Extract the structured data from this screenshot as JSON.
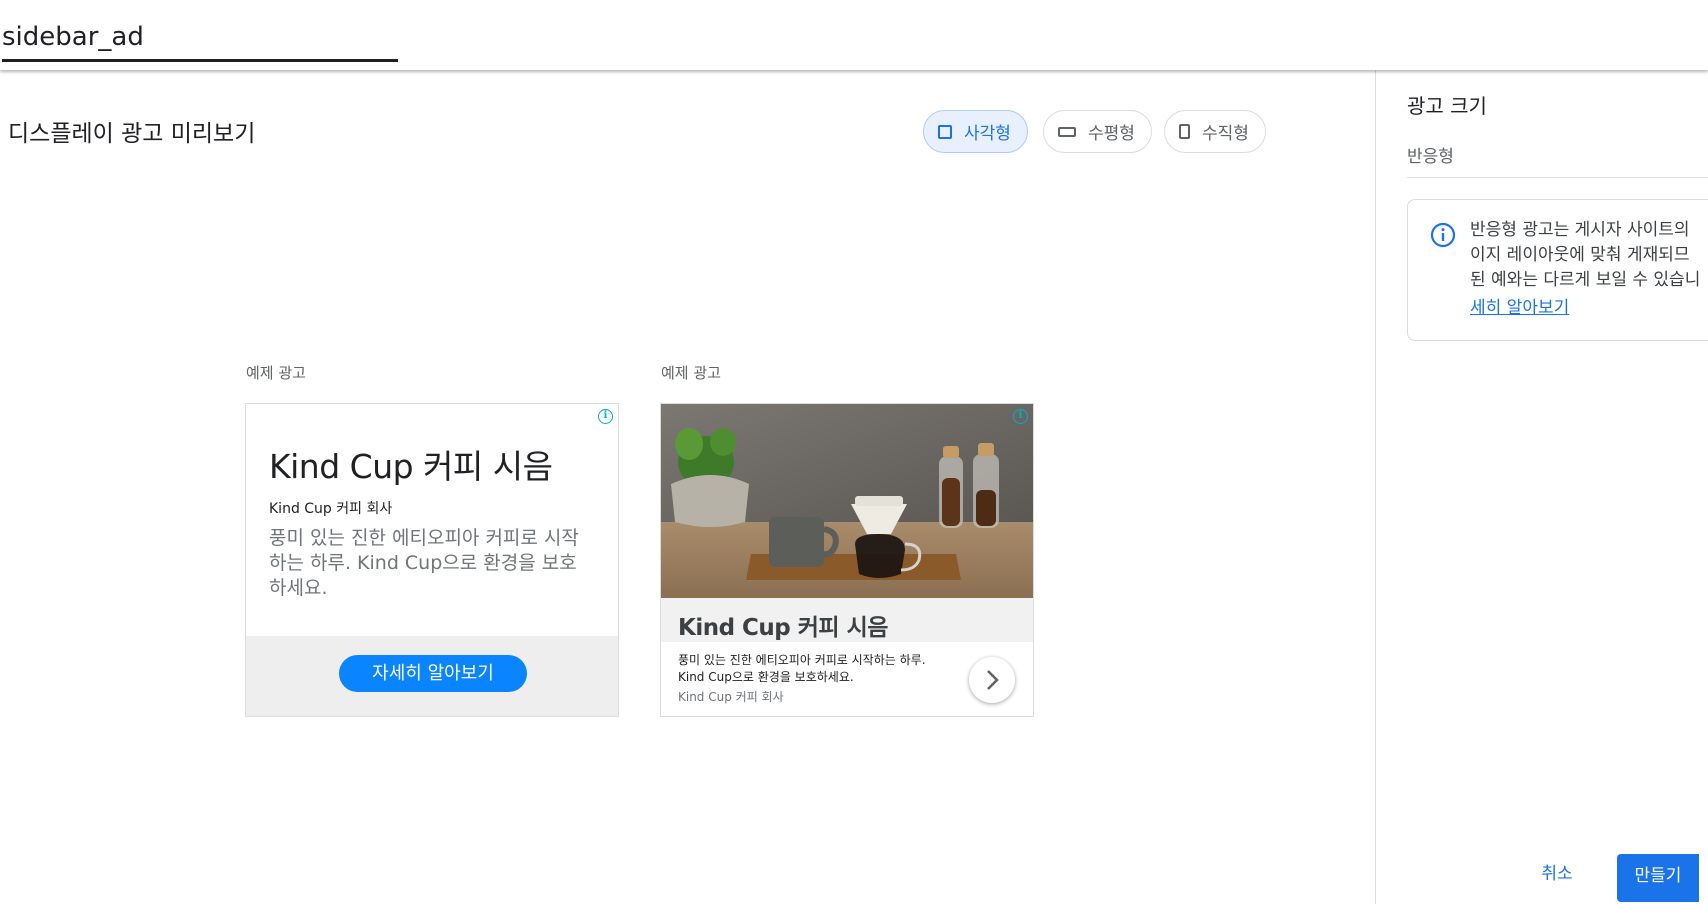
{
  "header": {
    "name_value": "sidebar_ad"
  },
  "main": {
    "title": "디스플레이 광고 미리보기",
    "shape_options": [
      {
        "label": "사각형",
        "icon": "square-icon",
        "selected": true
      },
      {
        "label": "수평형",
        "icon": "horizontal-rect-icon",
        "selected": false
      },
      {
        "label": "수직형",
        "icon": "vertical-rect-icon",
        "selected": false
      }
    ]
  },
  "ads": [
    {
      "label": "예제 광고",
      "headline": "Kind Cup 커피 시음",
      "business": "Kind Cup 커피 회사",
      "description": "풍미 있는 진한 에티오피아 커피로 시작하는 하루. Kind Cup으로 환경을 보호하세요.",
      "cta": "자세히 알아보기",
      "adchoices": "i"
    },
    {
      "label": "예제 광고",
      "headline": "Kind Cup 커피 시음",
      "description": "풍미 있는 진한 에티오피아 커피로 시작하는 하루. Kind Cup으로 환경을 보호하세요.",
      "business": "Kind Cup 커피 회사",
      "adchoices": "i",
      "image": "coffee-products-photo"
    }
  ],
  "side_panel": {
    "title": "광고 크기",
    "size_value": "반응형",
    "info_lines": [
      "반응형 광고는 게시자 사이트의",
      "이지 레이아웃에 맞춰 게재되므",
      "된 예와는 다르게 보일 수 있습니"
    ],
    "info_link": "세히 알아보기",
    "cancel_label": "취소",
    "create_label": "만들기"
  },
  "colors": {
    "accent": "#1a73e8",
    "cta": "#0a84ff",
    "selected_bg": "#e8f0fe"
  }
}
